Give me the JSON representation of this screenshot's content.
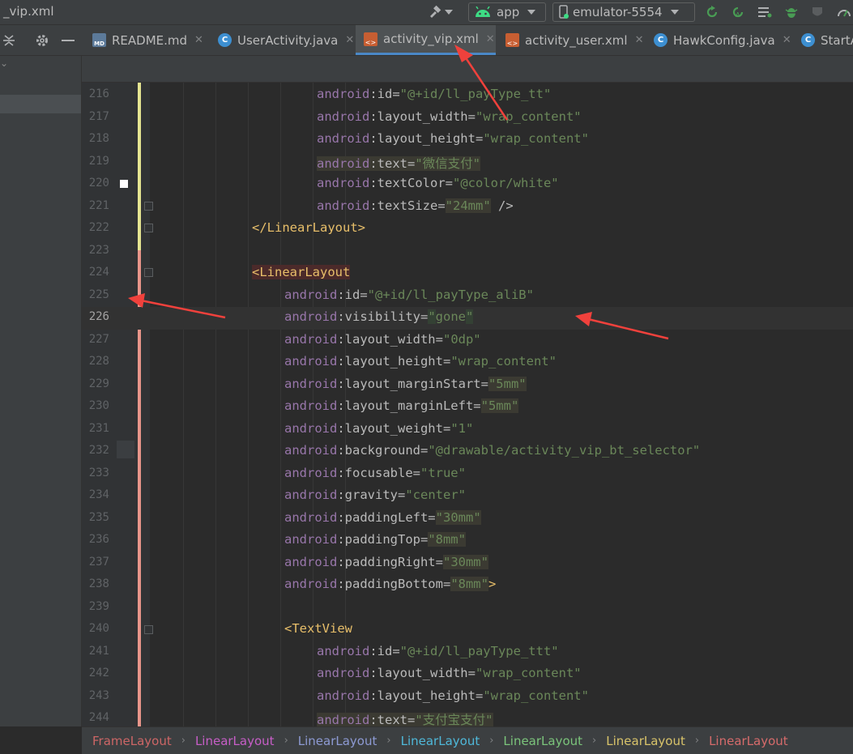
{
  "window": {
    "title": "_vip.xml"
  },
  "toolbar": {
    "run_config": "app",
    "device": "emulator-5554"
  },
  "tabs": [
    {
      "label": "README.md",
      "icon": "markdown-file-icon",
      "closable": true,
      "active": false
    },
    {
      "label": "UserActivity.java",
      "icon": "java-class-icon",
      "closable": true,
      "active": false
    },
    {
      "label": "activity_vip.xml",
      "icon": "xml-layout-icon",
      "closable": true,
      "active": true
    },
    {
      "label": "activity_user.xml",
      "icon": "xml-layout-icon",
      "closable": true,
      "active": false
    },
    {
      "label": "HawkConfig.java",
      "icon": "java-class-icon",
      "closable": true,
      "active": false
    },
    {
      "label": "StartA",
      "icon": "java-class-icon",
      "closable": false,
      "active": false
    }
  ],
  "tab_icon_glyphs": {
    "java": "C",
    "markdown": "MD",
    "xml": "<>"
  },
  "editor": {
    "current_line": 226,
    "lines": [
      {
        "num": "216",
        "indent": 4,
        "tokens": [
          [
            "ns",
            "android"
          ],
          [
            "attr",
            ":id="
          ],
          [
            "val",
            "\"@+id/ll_payType_tt\""
          ]
        ]
      },
      {
        "num": "217",
        "indent": 4,
        "tokens": [
          [
            "ns",
            "android"
          ],
          [
            "attr",
            ":layout_width="
          ],
          [
            "val",
            "\"wrap_content\""
          ]
        ]
      },
      {
        "num": "218",
        "indent": 4,
        "tokens": [
          [
            "ns",
            "android"
          ],
          [
            "attr",
            ":layout_height="
          ],
          [
            "val",
            "\"wrap_content\""
          ]
        ]
      },
      {
        "num": "219",
        "indent": 4,
        "tokens": [
          [
            "ns hl",
            "android"
          ],
          [
            "attr hl",
            ":text="
          ],
          [
            "val hl",
            "\"微信支付\""
          ]
        ]
      },
      {
        "num": "220",
        "indent": 4,
        "tokens": [
          [
            "ns",
            "android"
          ],
          [
            "attr",
            ":textColor="
          ],
          [
            "val",
            "\"@color/white\""
          ]
        ]
      },
      {
        "num": "221",
        "indent": 4,
        "tokens": [
          [
            "ns",
            "android"
          ],
          [
            "attr",
            ":textSize="
          ],
          [
            "val hl",
            "\"24mm\""
          ],
          [
            "attr",
            " />"
          ]
        ]
      },
      {
        "num": "222",
        "indent": 2,
        "tokens": [
          [
            "tag",
            "</LinearLayout>"
          ]
        ]
      },
      {
        "num": "223",
        "indent": 0,
        "tokens": []
      },
      {
        "num": "224",
        "indent": 2,
        "tokens": [
          [
            "tag tagbg",
            "<LinearLayout"
          ]
        ]
      },
      {
        "num": "225",
        "indent": 3,
        "tokens": [
          [
            "ns",
            "android"
          ],
          [
            "attr",
            ":id="
          ],
          [
            "val",
            "\"@+id/ll_payType_aliB\""
          ]
        ]
      },
      {
        "num": "226",
        "indent": 3,
        "tokens": [
          [
            "ns",
            "android"
          ],
          [
            "attr",
            ":visibility="
          ],
          [
            "val hlb",
            "\""
          ],
          [
            "val",
            "gone"
          ],
          [
            "val hlb",
            "\""
          ]
        ]
      },
      {
        "num": "227",
        "indent": 3,
        "tokens": [
          [
            "ns",
            "android"
          ],
          [
            "attr",
            ":layout_width="
          ],
          [
            "val",
            "\"0dp\""
          ]
        ]
      },
      {
        "num": "228",
        "indent": 3,
        "tokens": [
          [
            "ns",
            "android"
          ],
          [
            "attr",
            ":layout_height="
          ],
          [
            "val",
            "\"wrap_content\""
          ]
        ]
      },
      {
        "num": "229",
        "indent": 3,
        "tokens": [
          [
            "ns",
            "android"
          ],
          [
            "attr",
            ":layout_marginStart="
          ],
          [
            "val hl",
            "\"5mm\""
          ]
        ]
      },
      {
        "num": "230",
        "indent": 3,
        "tokens": [
          [
            "ns",
            "android"
          ],
          [
            "attr",
            ":layout_marginLeft="
          ],
          [
            "val hl",
            "\"5mm\""
          ]
        ]
      },
      {
        "num": "231",
        "indent": 3,
        "tokens": [
          [
            "ns",
            "android"
          ],
          [
            "attr",
            ":layout_weight="
          ],
          [
            "val",
            "\"1\""
          ]
        ]
      },
      {
        "num": "232",
        "indent": 3,
        "tokens": [
          [
            "ns",
            "android"
          ],
          [
            "attr",
            ":background="
          ],
          [
            "val",
            "\"@drawable/activity_vip_bt_selector\""
          ]
        ]
      },
      {
        "num": "233",
        "indent": 3,
        "tokens": [
          [
            "ns",
            "android"
          ],
          [
            "attr",
            ":focusable="
          ],
          [
            "val",
            "\"true\""
          ]
        ]
      },
      {
        "num": "234",
        "indent": 3,
        "tokens": [
          [
            "ns",
            "android"
          ],
          [
            "attr",
            ":gravity="
          ],
          [
            "val",
            "\"center\""
          ]
        ]
      },
      {
        "num": "235",
        "indent": 3,
        "tokens": [
          [
            "ns",
            "android"
          ],
          [
            "attr",
            ":paddingLeft="
          ],
          [
            "val hl",
            "\"30mm\""
          ]
        ]
      },
      {
        "num": "236",
        "indent": 3,
        "tokens": [
          [
            "ns",
            "android"
          ],
          [
            "attr",
            ":paddingTop="
          ],
          [
            "val hl",
            "\"8mm\""
          ]
        ]
      },
      {
        "num": "237",
        "indent": 3,
        "tokens": [
          [
            "ns",
            "android"
          ],
          [
            "attr",
            ":paddingRight="
          ],
          [
            "val hl",
            "\"30mm\""
          ]
        ]
      },
      {
        "num": "238",
        "indent": 3,
        "tokens": [
          [
            "ns",
            "android"
          ],
          [
            "attr",
            ":paddingBottom="
          ],
          [
            "val hl",
            "\"8mm\""
          ],
          [
            "tag",
            ">"
          ]
        ]
      },
      {
        "num": "239",
        "indent": 0,
        "tokens": []
      },
      {
        "num": "240",
        "indent": 3,
        "tokens": [
          [
            "tag",
            "<TextView"
          ]
        ]
      },
      {
        "num": "241",
        "indent": 4,
        "tokens": [
          [
            "ns",
            "android"
          ],
          [
            "attr",
            ":id="
          ],
          [
            "val",
            "\"@+id/ll_payType_ttt\""
          ]
        ]
      },
      {
        "num": "242",
        "indent": 4,
        "tokens": [
          [
            "ns",
            "android"
          ],
          [
            "attr",
            ":layout_width="
          ],
          [
            "val",
            "\"wrap_content\""
          ]
        ]
      },
      {
        "num": "243",
        "indent": 4,
        "tokens": [
          [
            "ns",
            "android"
          ],
          [
            "attr",
            ":layout_height="
          ],
          [
            "val",
            "\"wrap_content\""
          ]
        ]
      },
      {
        "num": "244",
        "indent": 4,
        "tokens": [
          [
            "ns hl",
            "android"
          ],
          [
            "attr hl",
            ":text="
          ],
          [
            "val hl",
            "\"支付宝支付\""
          ]
        ]
      }
    ]
  },
  "breadcrumb": [
    {
      "label": "FrameLayout",
      "color": "#cc6666"
    },
    {
      "label": "LinearLayout",
      "color": "#c65ec6"
    },
    {
      "label": "LinearLayout",
      "color": "#8d9ad3"
    },
    {
      "label": "LinearLayout",
      "color": "#4fb8d9"
    },
    {
      "label": "LinearLayout",
      "color": "#7bc47b"
    },
    {
      "label": "LinearLayout",
      "color": "#d8c36a"
    },
    {
      "label": "LinearLayout",
      "color": "#d66b6b"
    }
  ],
  "colors": {
    "accent": "#4a88c7",
    "annotation_arrow": "#f0413c",
    "vcs_modified": "#e5e591",
    "vcs_deleted": "#e8958a"
  }
}
